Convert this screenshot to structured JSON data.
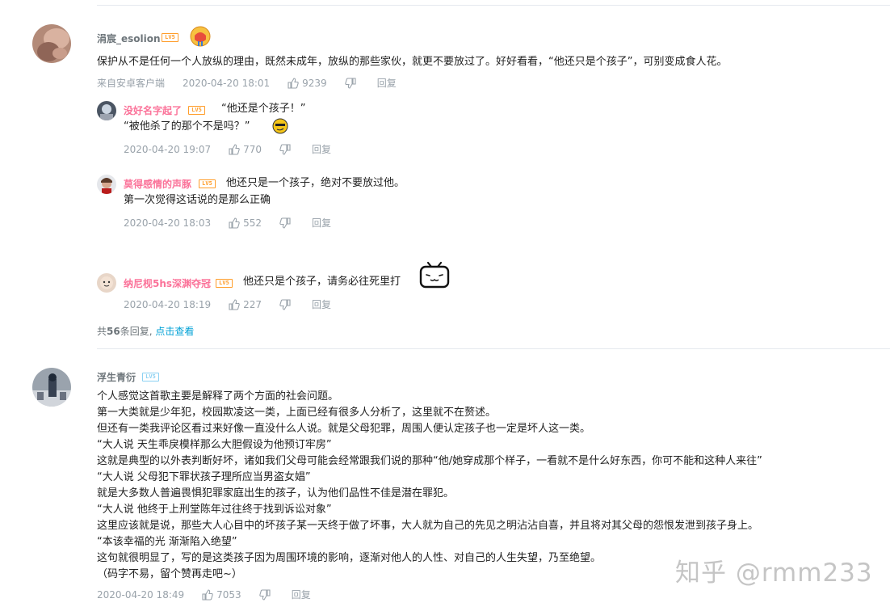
{
  "comments": [
    {
      "username": "涓宸_esolion",
      "level": "LV5",
      "text": "保护从不是任何一个人放纵的理由，既然未成年，放纵的那些家伙，就更不要放过了。好好看看，“他还只是个孩子”，可别变成食人花。",
      "source": "来自安卓客户端",
      "time": "2020-04-20 18:01",
      "likes": "9239",
      "reply_label": "回复",
      "replies": [
        {
          "username": "没好名字起了",
          "level": "LV5",
          "line1": "“他还是个孩子！”",
          "line2": "“被他杀了的那个不是吗？”",
          "time": "2020-04-20 19:07",
          "likes": "770",
          "reply_label": "回复"
        },
        {
          "username": "莫得感情的声豚",
          "level": "LV5",
          "line1": "他还只是一个孩子，绝对不要放过他。",
          "line2": "第一次觉得这话说的是那么正确",
          "time": "2020-04-20 18:03",
          "likes": "552",
          "reply_label": "回复"
        },
        {
          "username": "纳尼枧5hs深渊夺冠",
          "level": "LV5",
          "line1": "他还只是个孩子，请务必往死里打",
          "time": "2020-04-20 18:19",
          "likes": "227",
          "reply_label": "回复"
        }
      ],
      "more_prefix": "共",
      "more_count": "56",
      "more_suffix": "条回复,",
      "more_link": "点击查看"
    },
    {
      "username": "浮生青衍",
      "level": "LV5",
      "lines": [
        "个人感觉这首歌主要是解释了两个方面的社会问题。",
        "第一大类就是少年犯，校园欺凌这一类，上面已经有很多人分析了，这里就不在赘述。",
        "但还有一类我评论区看过来好像一直没什么人说。就是父母犯罪，周围人便认定孩子也一定是坏人这一类。",
        "“大人说 天生乖戾模样那么大胆假设为他预订牢房”",
        "这就是典型的以外表判断好坏，诸如我们父母可能会经常跟我们说的那种“他/她穿成那个样子，一看就不是什么好东西，你可不能和这种人来往”",
        "“大人说 父母犯下罪状孩子理所应当男盗女娼”",
        "就是大多数人普遍畏惧犯罪家庭出生的孩子，认为他们品性不佳是潜在罪犯。",
        "“大人说 他终于上刑堂陈年过往终于找到诉讼对象”",
        "这里应该就是说，那些大人心目中的坏孩子某一天终于做了坏事，大人就为自己的先见之明沾沾自喜，并且将对其父母的怨恨发泄到孩子身上。",
        "“本该幸福的光 渐渐陷入绝望”",
        "这句就很明显了，写的是这类孩子因为周围环境的影响，逐渐对他人的人性、对自己的人生失望，乃至绝望。",
        "（码字不易，留个赞再走吧~）"
      ],
      "time": "2020-04-20 18:49",
      "likes": "7053",
      "reply_label": "回复"
    }
  ],
  "watermark": "知乎 @rmm233",
  "colors": {
    "accent_link": "#00a1d6",
    "pink_name": "#fb7299",
    "meta": "#99a2aa",
    "level_orange": "#ff9d2a",
    "level_blue": "#8bd1f2"
  },
  "icons": [
    "like-icon",
    "dislike-icon",
    "emoji-sticker-icon",
    "bilibili-tv-icon"
  ]
}
